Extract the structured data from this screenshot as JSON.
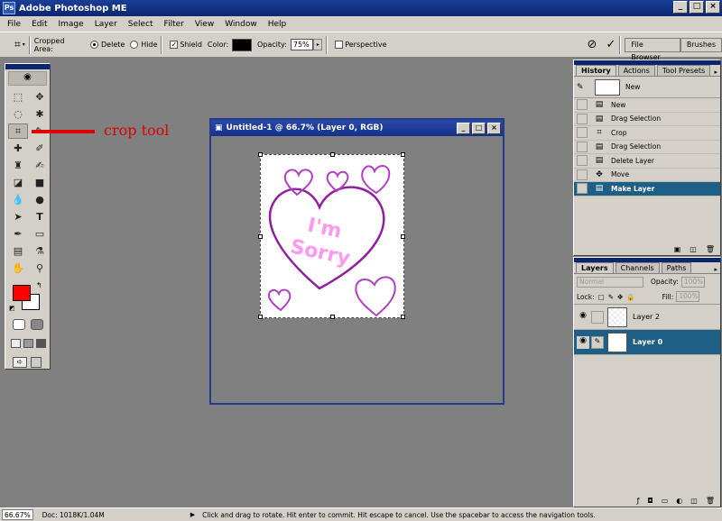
{
  "app": {
    "title": "Adobe Photoshop ME",
    "window_buttons": [
      "_",
      "□",
      "×"
    ]
  },
  "menu": [
    "File",
    "Edit",
    "Image",
    "Layer",
    "Select",
    "Filter",
    "View",
    "Window",
    "Help"
  ],
  "options": {
    "cropped_area_label": "Cropped Area:",
    "delete_label": "Delete",
    "hide_label": "Hide",
    "shield_label": "Shield",
    "color_label": "Color:",
    "opacity_label": "Opacity:",
    "opacity_value": "75%",
    "perspective_label": "Perspective",
    "file_browser": "File Browser",
    "brushes": "Brushes"
  },
  "annotation": "crop tool",
  "document": {
    "title": "Untitled-1 @ 66.7% (Layer 0, RGB)",
    "text_im": "I'm",
    "text_sorry": "Sorry"
  },
  "history_panel": {
    "tabs": [
      "History",
      "Actions",
      "Tool Presets"
    ],
    "snapshot": "New",
    "items": [
      "New",
      "Drag Selection",
      "Crop",
      "Drag Selection",
      "Delete Layer",
      "Move",
      "Make Layer"
    ]
  },
  "layers_panel": {
    "tabs": [
      "Layers",
      "Channels",
      "Paths"
    ],
    "blend_mode": "Normal",
    "opacity_label": "Opacity:",
    "opacity_value": "100%",
    "lock_label": "Lock:",
    "fill_label": "Fill:",
    "fill_value": "100%",
    "layers": [
      "Layer 2",
      "Layer 0"
    ]
  },
  "status": {
    "zoom": "66.67%",
    "doc": "Doc: 1018K/1.04M",
    "message": "Click and drag to rotate. Hit enter to commit. Hit escape to cancel. Use the spacebar to access the navigation tools."
  },
  "colors": {
    "foreground": "#ff0000",
    "background": "#ffffff",
    "accent": "#1e5f86"
  }
}
